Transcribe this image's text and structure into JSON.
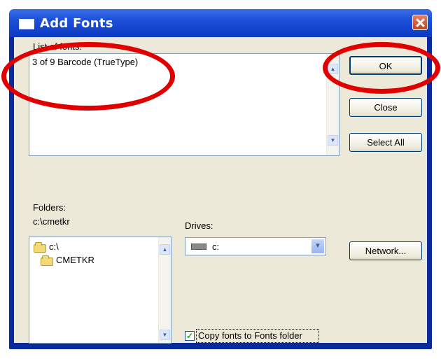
{
  "window": {
    "title": "Add Fonts",
    "close_symbol": "close-icon"
  },
  "fonts": {
    "label": "List of fonts:",
    "items": [
      "3 of 9 Barcode (TrueType)"
    ]
  },
  "buttons": {
    "ok": "OK",
    "close": "Close",
    "select_all": "Select All",
    "network": "Network..."
  },
  "folders": {
    "label": "Folders:",
    "current_path": "c:\\cmetkr",
    "items": [
      {
        "label": "c:\\",
        "icon": "open-folder-icon"
      },
      {
        "label": "CMETKR",
        "icon": "open-folder-icon"
      }
    ]
  },
  "drives": {
    "label": "Drives:",
    "selected": "c:",
    "icon": "hard-drive-icon"
  },
  "copy_option": {
    "label": "Copy fonts to Fonts folder",
    "checked": true
  },
  "annotations": {
    "color": "#e00000"
  }
}
